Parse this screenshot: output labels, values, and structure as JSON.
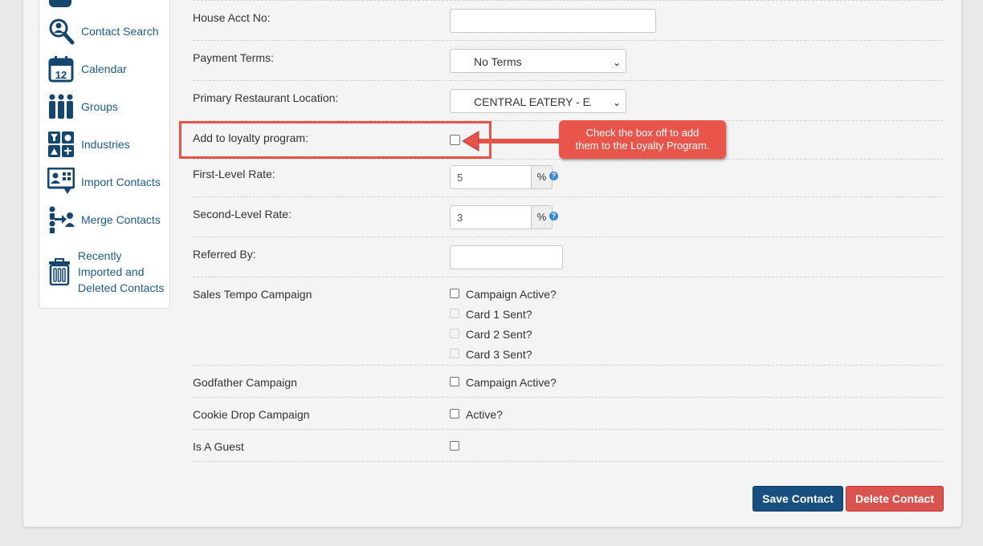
{
  "sidebar": {
    "items": [
      {
        "label": "Contact Search",
        "icon": "contact-search-icon"
      },
      {
        "label": "Calendar",
        "icon": "calendar-icon",
        "icon_text": "12"
      },
      {
        "label": "Groups",
        "icon": "groups-icon"
      },
      {
        "label": "Industries",
        "icon": "industries-icon"
      },
      {
        "label": "Import Contacts",
        "icon": "import-contacts-icon"
      },
      {
        "label": "Merge Contacts",
        "icon": "merge-contacts-icon"
      },
      {
        "label_lines": [
          "Recently",
          "Imported and",
          "Deleted Contacts"
        ],
        "icon": "trash-icon"
      }
    ]
  },
  "form": {
    "house_acct": {
      "label": "House Acct No:",
      "value": ""
    },
    "payment_terms": {
      "label": "Payment Terms:",
      "value": "No Terms"
    },
    "primary_location": {
      "label": "Primary Restaurant Location:",
      "value": "CENTRAL EATERY - EA"
    },
    "loyalty": {
      "label": "Add to loyalty program:",
      "checked": false
    },
    "first_level": {
      "label": "First-Level Rate:",
      "value": "5",
      "unit": "%"
    },
    "second_level": {
      "label": "Second-Level Rate:",
      "value": "3",
      "unit": "%"
    },
    "referred_by": {
      "label": "Referred By:",
      "value": ""
    },
    "sales_tempo": {
      "label": "Sales Tempo Campaign",
      "options": [
        "Campaign Active?",
        "Card 1 Sent?",
        "Card 2 Sent?",
        "Card 3 Sent?"
      ]
    },
    "godfather": {
      "label": "Godfather Campaign",
      "option": "Campaign Active?"
    },
    "cookie_drop": {
      "label": "Cookie Drop Campaign",
      "option": "Active?"
    },
    "is_guest": {
      "label": "Is A Guest"
    }
  },
  "callout": {
    "line1": "Check the box off to add",
    "line2": "them to the Loyalty Program."
  },
  "buttons": {
    "save": "Save Contact",
    "delete": "Delete Contact"
  },
  "colors": {
    "primary": "#174f80",
    "danger": "#d9534f",
    "highlight": "#e5534a",
    "link": "#1d5c8c"
  }
}
